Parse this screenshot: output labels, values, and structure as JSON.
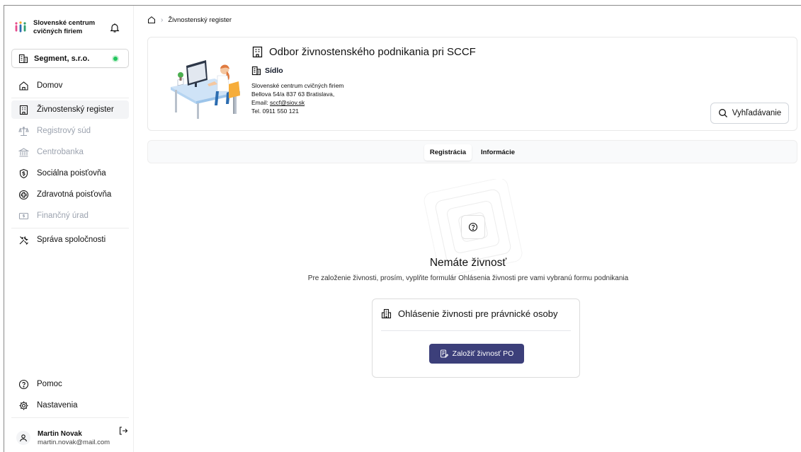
{
  "sidebar": {
    "brand": "Slovenské centrum cvičných firiem",
    "company": "Segment, s.r.o.",
    "items": [
      {
        "label": "Domov"
      },
      {
        "label": "Živnostenský register"
      },
      {
        "label": "Registrový súd"
      },
      {
        "label": "Centrobanka"
      },
      {
        "label": "Sociálna poisťovňa"
      },
      {
        "label": "Zdravotná poisťovňa"
      },
      {
        "label": "Finančný úrad"
      },
      {
        "label": "Správa spoločnosti"
      }
    ],
    "bottom": [
      {
        "label": "Pomoc"
      },
      {
        "label": "Nastavenia"
      }
    ],
    "user": {
      "name": "Martin Novak",
      "email": "martin.novak@mail.com"
    }
  },
  "breadcrumb": {
    "current": "Živnostenský register"
  },
  "office": {
    "title": "Odbor živnostenského podnikania pri SCCF",
    "seat_label": "Sídlo",
    "line1": "Slovenské centrum cvičných firiem",
    "line2": "Bellova 54/a 837 63 Bratislava,",
    "email_prefix": "Email: ",
    "email": "sccf@siov.sk",
    "phone": "Tel. 0911 550 121"
  },
  "search": {
    "label": "Vyhľadávanie"
  },
  "tabs": [
    {
      "label": "Registrácia"
    },
    {
      "label": "Informácie"
    }
  ],
  "empty": {
    "title": "Nemáte živnosť",
    "description": "Pre založenie živnosti, prosím, vyplňte formulár Ohlásenia živnosti pre vami vybranú formu podnikania"
  },
  "form": {
    "title": "Ohlásenie živnosti pre právnické osoby",
    "button": "Založiť živnosť PO"
  },
  "colors": {
    "primary": "#3c3f7a",
    "status_online": "#22c55e",
    "active_bg": "#f3f4f6"
  }
}
